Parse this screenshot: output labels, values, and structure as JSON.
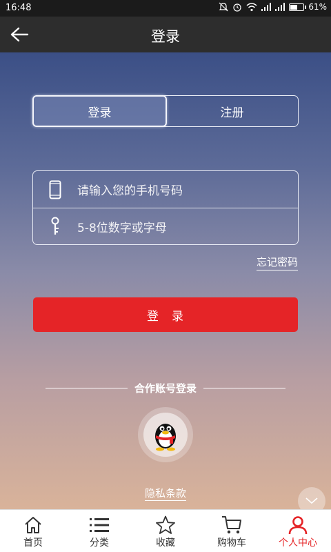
{
  "status_bar": {
    "time": "16:48",
    "battery": "61%",
    "battery_level": 0.61
  },
  "header": {
    "title": "登录",
    "back_icon": "arrow-left-icon"
  },
  "tabs": [
    {
      "label": "登录",
      "active": true
    },
    {
      "label": "注册",
      "active": false
    }
  ],
  "form": {
    "phone_placeholder": "请输入您的手机号码",
    "password_placeholder": "5-8位数字或字母",
    "phone_icon": "phone-icon",
    "password_icon": "key-icon"
  },
  "forgot_password": "忘记密码",
  "login_button": "登　录",
  "partner": {
    "title": "合作账号登录",
    "qq_icon": "qq-penguin-icon"
  },
  "privacy": "隐私条款",
  "bottom_nav": [
    {
      "label": "首页",
      "icon": "home-icon",
      "active": false
    },
    {
      "label": "分类",
      "icon": "list-icon",
      "active": false
    },
    {
      "label": "收藏",
      "icon": "star-icon",
      "active": false
    },
    {
      "label": "购物车",
      "icon": "cart-icon",
      "active": false
    },
    {
      "label": "个人中心",
      "icon": "user-icon",
      "active": true
    }
  ],
  "colors": {
    "accent": "#e52427",
    "header": "#2d2d2d"
  }
}
